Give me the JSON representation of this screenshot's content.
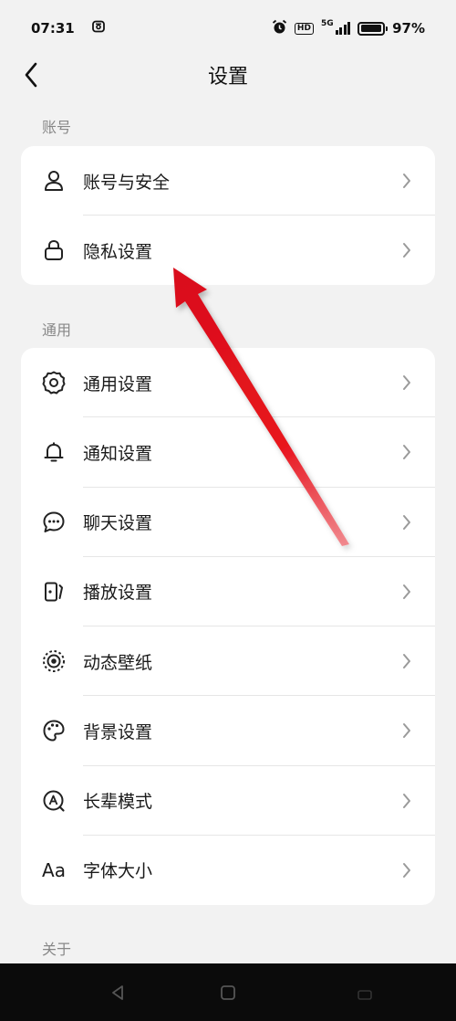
{
  "status": {
    "time": "07:31",
    "hd": "HD",
    "network": "5G",
    "battery": "97%",
    "battery_level": 0.97
  },
  "header": {
    "title": "设置",
    "back_icon": "chevron-left-icon"
  },
  "sections": {
    "account": {
      "label": "账号",
      "items": [
        {
          "label": "账号与安全",
          "icon": "person-icon"
        },
        {
          "label": "隐私设置",
          "icon": "lock-icon"
        }
      ]
    },
    "general": {
      "label": "通用",
      "items": [
        {
          "label": "通用设置",
          "icon": "gear-icon"
        },
        {
          "label": "通知设置",
          "icon": "bell-icon"
        },
        {
          "label": "聊天设置",
          "icon": "chat-bubble-icon"
        },
        {
          "label": "播放设置",
          "icon": "playback-icon"
        },
        {
          "label": "动态壁纸",
          "icon": "live-wallpaper-icon"
        },
        {
          "label": "背景设置",
          "icon": "palette-icon"
        },
        {
          "label": "长辈模式",
          "icon": "elder-mode-icon"
        },
        {
          "label": "字体大小",
          "icon": "font-size-icon",
          "glyph": "Aa"
        }
      ]
    },
    "about": {
      "label": "关于"
    }
  },
  "annotation": {
    "type": "red-arrow",
    "color": "#e8141f",
    "points_to": "隐私设置"
  },
  "colors": {
    "background": "#f2f2f2",
    "card": "#ffffff",
    "section_label": "#888888",
    "chevron": "#9a9a9a",
    "arrow": "#e8141f"
  }
}
